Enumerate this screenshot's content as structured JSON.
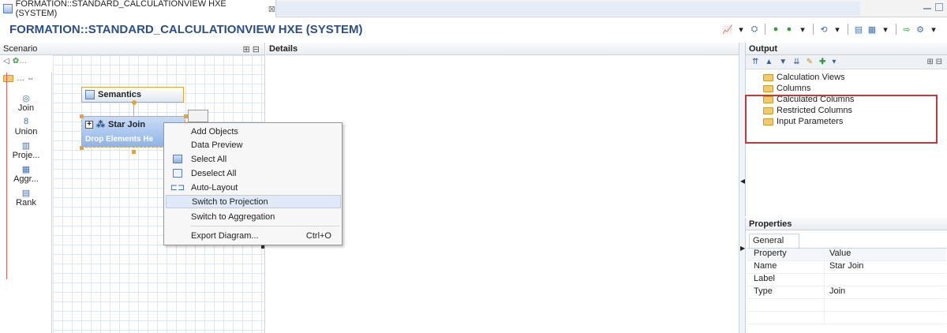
{
  "window": {
    "tab_title": "FORMATION::STANDARD_CALCULATIONVIEW HXE (SYSTEM)",
    "tab_close": "⊠"
  },
  "header": {
    "title": "FORMATION::STANDARD_CALCULATIONVIEW HXE (SYSTEM)"
  },
  "scenario": {
    "label": "Scenario",
    "palette": [
      {
        "label": "Join",
        "icon": "join-icon"
      },
      {
        "label": "Union",
        "icon": "union-icon"
      },
      {
        "label": "Proje...",
        "icon": "projection-icon"
      },
      {
        "label": "Aggr...",
        "icon": "aggregation-icon"
      },
      {
        "label": "Rank",
        "icon": "rank-icon"
      }
    ],
    "nodes": {
      "semantics": "Semantics",
      "star_join": "Star Join",
      "drop_hint": "Drop Elements He"
    }
  },
  "details": {
    "label": "Details"
  },
  "context_menu": {
    "items": [
      {
        "label": "Add Objects",
        "shortcut": ""
      },
      {
        "label": "Data Preview",
        "shortcut": ""
      },
      {
        "label": "Select All",
        "shortcut": ""
      },
      {
        "label": "Deselect All",
        "shortcut": ""
      },
      {
        "label": "Auto-Layout",
        "shortcut": ""
      },
      {
        "label": "Switch to Projection",
        "shortcut": ""
      },
      {
        "label": "Switch to Aggregation",
        "shortcut": ""
      },
      {
        "label": "Export Diagram...",
        "shortcut": "Ctrl+O"
      }
    ],
    "highlighted": "Switch to Projection"
  },
  "output": {
    "label": "Output",
    "tree": [
      "Calculation Views",
      "Columns",
      "Calculated Columns",
      "Restricted Columns",
      "Input Parameters"
    ]
  },
  "properties": {
    "label": "Properties",
    "tab": "General",
    "headers": {
      "property": "Property",
      "value": "Value"
    },
    "rows": [
      {
        "property": "Name",
        "value": "Star Join"
      },
      {
        "property": "Label",
        "value": ""
      },
      {
        "property": "Type",
        "value": "Join"
      }
    ]
  },
  "colors": {
    "title": "#2a4f86",
    "highlight_box": "#c0393b",
    "node_border": "#e6a42a"
  }
}
